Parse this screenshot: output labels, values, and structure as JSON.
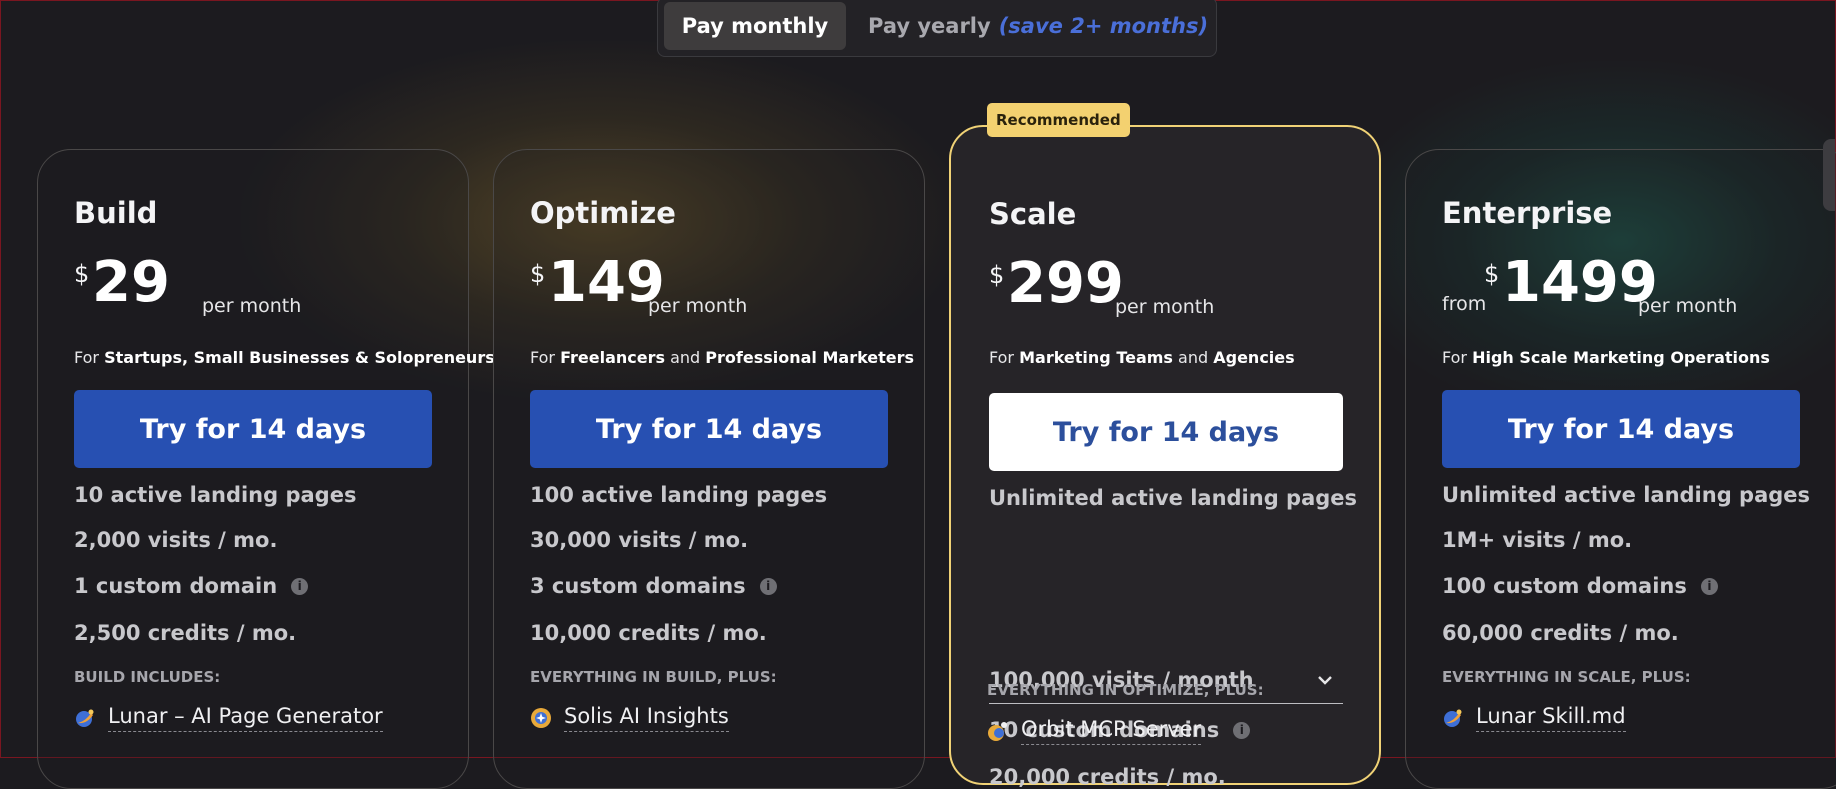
{
  "toggle": {
    "monthly": "Pay monthly",
    "yearly": "Pay yearly",
    "yearly_note": "(save 2+ months)"
  },
  "badge": "Recommended",
  "plans": [
    {
      "name": "Build",
      "from": "",
      "currency": "$",
      "amount": "29",
      "period": "per month",
      "audience": [
        "For ",
        "Startups, Small Businesses & Solopreneurs",
        "",
        ""
      ],
      "cta": "Try for 14 days",
      "features": [
        "10 active landing pages",
        "2,000 visits / mo.",
        "1 custom domain",
        "2,500 credits / mo."
      ],
      "includes_label": "BUILD INCLUDES:",
      "addon": "Lunar – AI Page Generator"
    },
    {
      "name": "Optimize",
      "from": "",
      "currency": "$",
      "amount": "149",
      "period": "per month",
      "audience": [
        "For ",
        "Freelancers",
        " and ",
        "Professional Marketers"
      ],
      "cta": "Try for 14 days",
      "features": [
        "100 active landing pages",
        "30,000 visits / mo.",
        "3 custom domains",
        "10,000 credits / mo."
      ],
      "includes_label": "EVERYTHING IN BUILD, PLUS:",
      "addon": "Solis AI Insights"
    },
    {
      "name": "Scale",
      "from": "",
      "currency": "$",
      "amount": "299",
      "period": "per month",
      "audience": [
        "For ",
        "Marketing Teams",
        " and ",
        "Agencies"
      ],
      "cta": "Try for 14 days",
      "features": [
        "Unlimited active landing pages",
        "100,000 visits / month",
        "10 custom domains",
        "20,000 credits / mo."
      ],
      "includes_label": "EVERYTHING IN OPTIMIZE, PLUS:",
      "addon": "Orbit MCP Server"
    },
    {
      "name": "Enterprise",
      "from": "from",
      "currency": "$",
      "amount": "1499",
      "period": "per month",
      "audience": [
        "For ",
        "High Scale Marketing Operations",
        "",
        ""
      ],
      "cta": "Try for 14 days",
      "features": [
        "Unlimited active landing pages",
        "1M+ visits / mo.",
        "100 custom domains",
        "60,000 credits / mo."
      ],
      "includes_label": "EVERYTHING IN SCALE, PLUS:",
      "addon": "Lunar Skill.md"
    }
  ]
}
